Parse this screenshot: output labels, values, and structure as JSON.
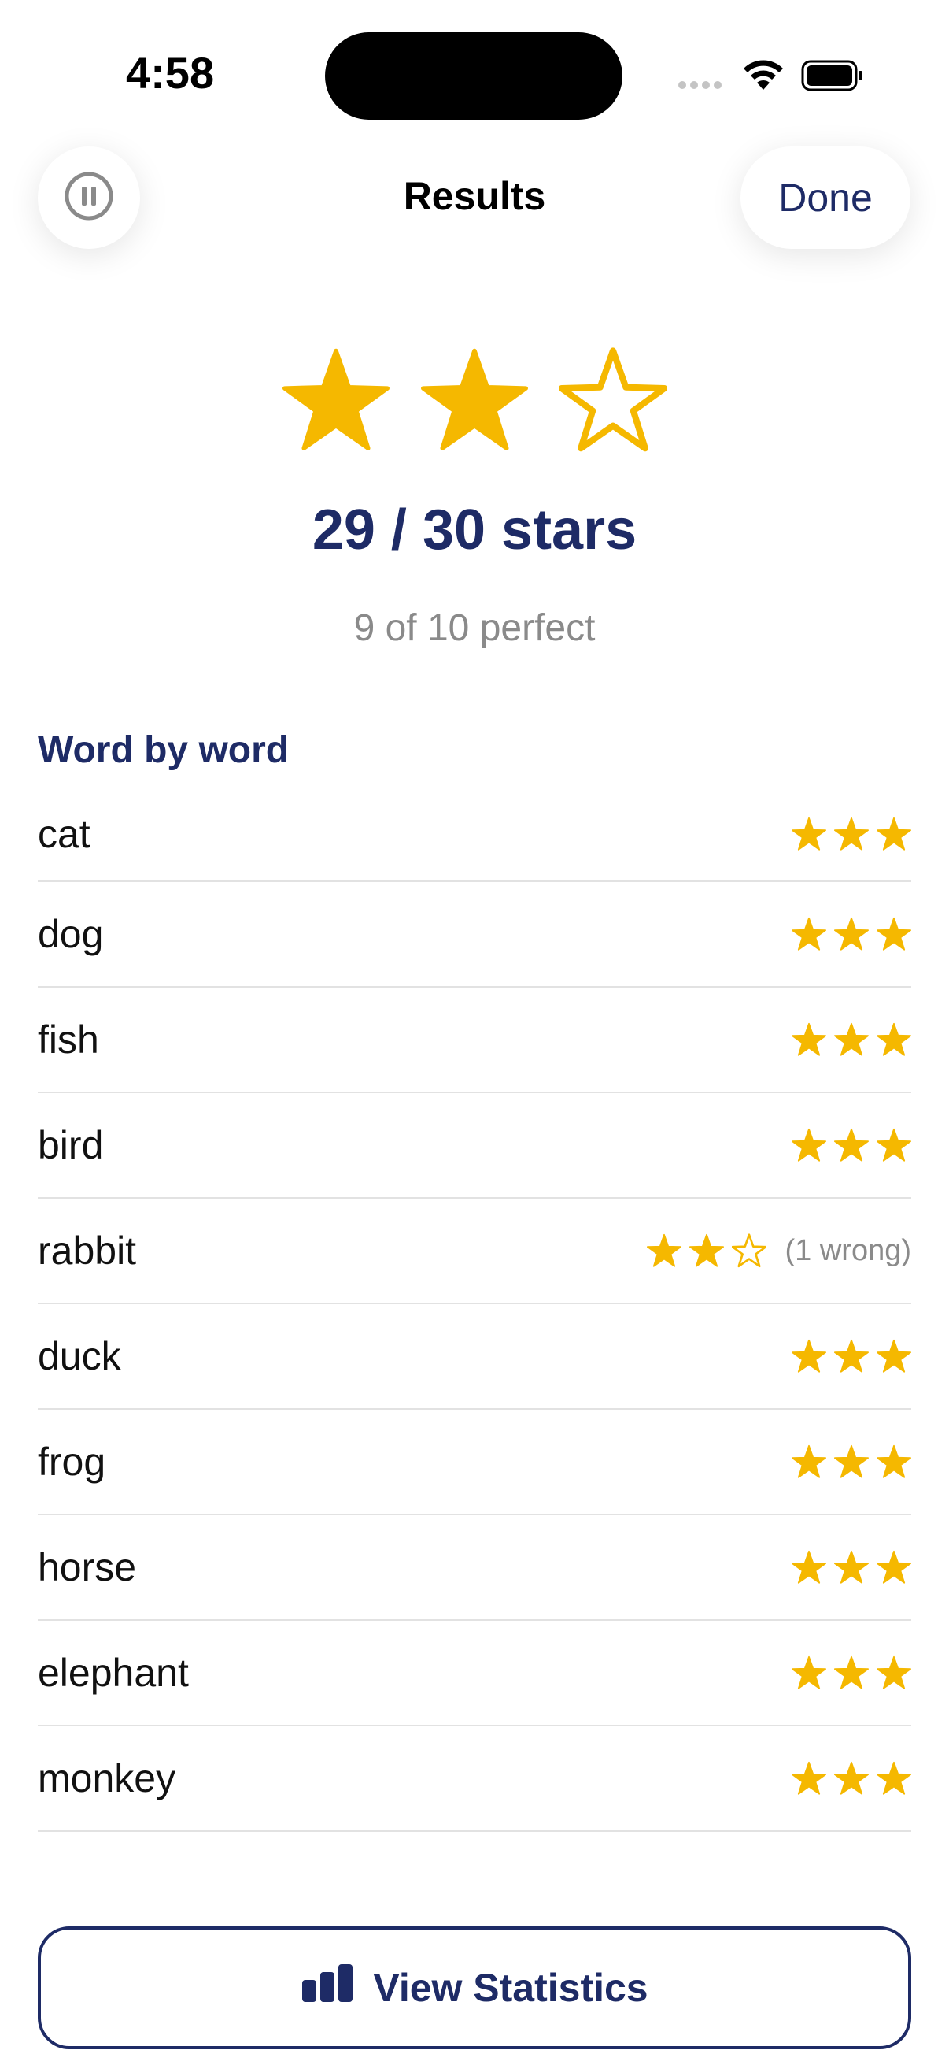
{
  "status_bar": {
    "time": "4:58"
  },
  "nav": {
    "title": "Results",
    "done_label": "Done",
    "left_icon": "pause-icon"
  },
  "summary": {
    "rating": 2,
    "rating_max": 3,
    "score_text": "29 / 30 stars",
    "perfect_text": "9 of 10 perfect"
  },
  "section": {
    "title": "Word by word"
  },
  "words": [
    {
      "word": "cat",
      "stars": 3,
      "note": ""
    },
    {
      "word": "dog",
      "stars": 3,
      "note": ""
    },
    {
      "word": "fish",
      "stars": 3,
      "note": ""
    },
    {
      "word": "bird",
      "stars": 3,
      "note": ""
    },
    {
      "word": "rabbit",
      "stars": 2,
      "note": "(1 wrong)"
    },
    {
      "word": "duck",
      "stars": 3,
      "note": ""
    },
    {
      "word": "frog",
      "stars": 3,
      "note": ""
    },
    {
      "word": "horse",
      "stars": 3,
      "note": ""
    },
    {
      "word": "elephant",
      "stars": 3,
      "note": ""
    },
    {
      "word": "monkey",
      "stars": 3,
      "note": ""
    }
  ],
  "footer": {
    "stats_button_label": "View Statistics",
    "stats_icon": "bar-chart-icon"
  },
  "colors": {
    "accent_navy": "#1e2b66",
    "star_gold": "#f5b800",
    "muted_text": "#8a8a8a",
    "divider": "#e2e2e2"
  }
}
